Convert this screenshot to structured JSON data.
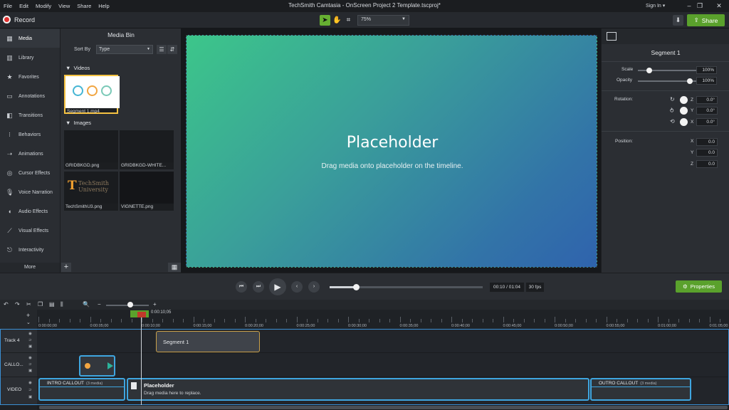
{
  "menubar": {
    "items": [
      "File",
      "Edit",
      "Modify",
      "View",
      "Share",
      "Help"
    ],
    "title": "TechSmith Camtasia - OnScreen Project 2 Template.tscproj*",
    "sign_in": "Sign In ▾"
  },
  "toolbar": {
    "record_label": "Record",
    "zoom_value": "75%",
    "share_label": "Share"
  },
  "leftnav": {
    "items": [
      {
        "label": "Media",
        "icon": "media-icon"
      },
      {
        "label": "Library",
        "icon": "library-icon"
      },
      {
        "label": "Favorites",
        "icon": "star-icon"
      },
      {
        "label": "Annotations",
        "icon": "annotation-icon"
      },
      {
        "label": "Transitions",
        "icon": "transition-icon"
      },
      {
        "label": "Behaviors",
        "icon": "behavior-icon"
      },
      {
        "label": "Animations",
        "icon": "animation-icon"
      },
      {
        "label": "Cursor Effects",
        "icon": "cursor-icon"
      },
      {
        "label": "Voice Narration",
        "icon": "microphone-icon"
      },
      {
        "label": "Audio Effects",
        "icon": "audio-icon"
      },
      {
        "label": "Visual Effects",
        "icon": "wand-icon"
      },
      {
        "label": "Interactivity",
        "icon": "interactivity-icon"
      }
    ],
    "more_label": "More"
  },
  "mediabin": {
    "title": "Media Bin",
    "sort_by_label": "Sort By",
    "sort_value": "Type",
    "videos_label": "Videos",
    "images_label": "Images",
    "videos": [
      "Segment 1.mp4"
    ],
    "images": [
      "GRIDBKGD.png",
      "GRIDBKGD-WHITE...",
      "TechSmithU3.png",
      "VIGNETTE.png"
    ],
    "techsmith_logo_line1": "TechSmith",
    "techsmith_logo_line2": "University"
  },
  "canvas": {
    "title": "Placeholder",
    "subtitle": "Drag media onto placeholder on the timeline."
  },
  "properties": {
    "title": "Segment 1",
    "scale_label": "Scale",
    "scale_value": "100%",
    "opacity_label": "Opacity",
    "opacity_value": "100%",
    "rotation_label": "Rotation:",
    "rotation": {
      "z": "0.0°",
      "y": "0.0°",
      "x": "0.0°"
    },
    "position_label": "Position:",
    "position": {
      "x": "0.0",
      "y": "0.0",
      "z": "0.0"
    },
    "axis_x": "X",
    "axis_y": "Y",
    "axis_z": "Z"
  },
  "playback": {
    "time": "00:10 / 01:04",
    "fps": "30 fps",
    "properties_label": "Properties",
    "progress": 0.17
  },
  "timeline": {
    "playhead_time": "0:00:10;05",
    "ruler_labels": [
      "0:00:00;00",
      "0:00:05;00",
      "0:00:10;00",
      "0:00:15;00",
      "0:00:20;00",
      "0:00:25;00",
      "0:00:30;00",
      "0:00:35;00",
      "0:00:40;00",
      "0:00:45;00",
      "0:00:50;00",
      "0:00:55;00",
      "0:01:00;00",
      "0:01:05;00"
    ],
    "tracks": [
      "Track 4",
      "CALLO...",
      "VIDEO"
    ],
    "clips": {
      "segment": "Segment 1",
      "intro": "INTRO CALLOUT",
      "intro_count": "(3 media)",
      "placeholder": "Placeholder",
      "placeholder_sub": "Drag media here to replace.",
      "outro": "OUTRO CALLOUT",
      "outro_count": "(3 media)"
    }
  }
}
